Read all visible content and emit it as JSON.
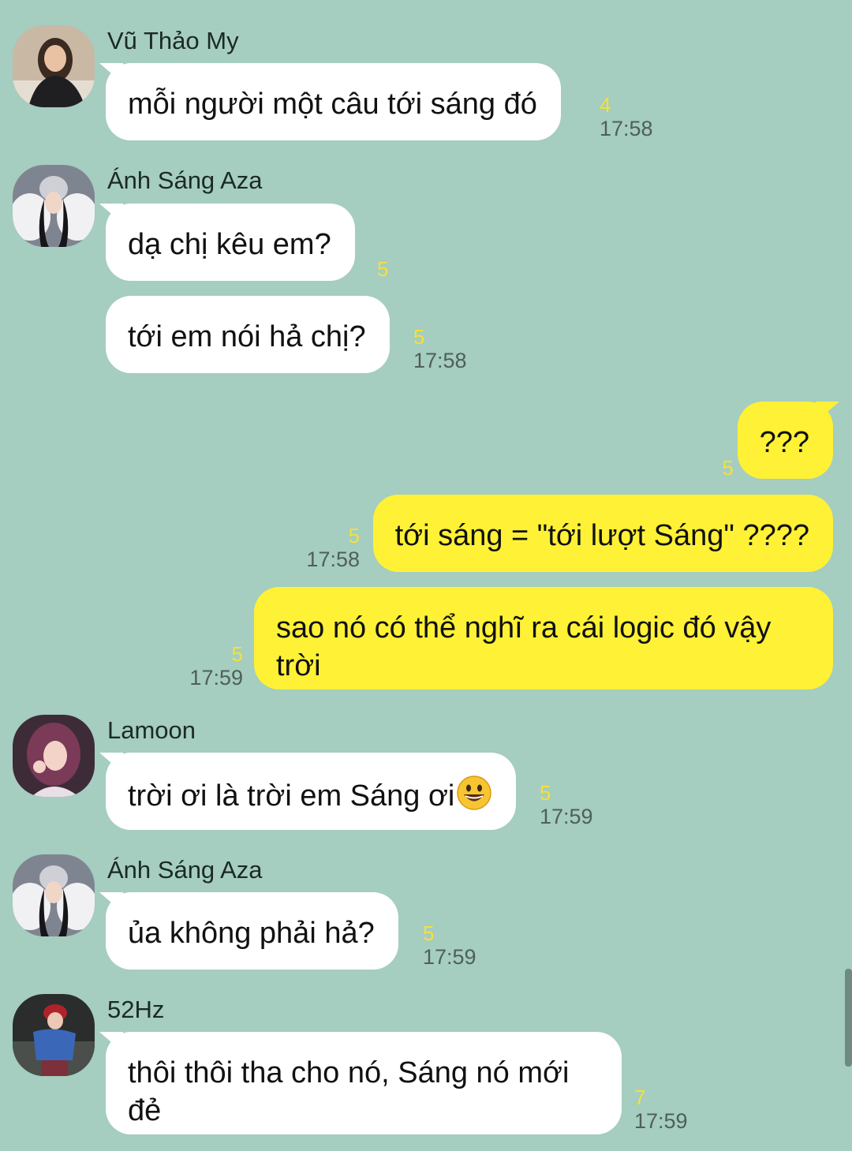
{
  "messages": [
    {
      "sender": "Vũ Thảo My",
      "text": "mỗi người một câu tới sáng đó",
      "unread": "4",
      "time": "17:58"
    },
    {
      "sender": "Ánh Sáng Aza",
      "text": "dạ chị kêu em?",
      "unread": "5",
      "time": ""
    },
    {
      "sender": "Ánh Sáng Aza",
      "text": "tới em nói hả chị?",
      "unread": "5",
      "time": "17:58"
    },
    {
      "sender": "me",
      "text": "???",
      "unread": "5",
      "time": ""
    },
    {
      "sender": "me",
      "text": "tới sáng = \"tới lượt Sáng\" ????",
      "unread": "5",
      "time": "17:58"
    },
    {
      "sender": "me",
      "text": "sao nó có thể nghĩ ra cái logic đó vậy trời",
      "unread": "5",
      "time": "17:59"
    },
    {
      "sender": "Lamoon",
      "text": "trời ơi là trời em Sáng ơi",
      "unread": "5",
      "time": "17:59"
    },
    {
      "sender": "Ánh Sáng Aza",
      "text": "ủa không phải hả?",
      "unread": "5",
      "time": "17:59"
    },
    {
      "sender": "52Hz",
      "text": "thôi thôi tha cho nó, Sáng nó mới đẻ",
      "unread": "7",
      "time": "17:59"
    }
  ],
  "emoji": "grinning-face-emoji",
  "colors": {
    "background": "#a5cdc0",
    "incoming_bubble": "#ffffff",
    "outgoing_bubble": "#fef136",
    "unread_count": "#f5e03a",
    "timestamp": "#4f5f5a"
  }
}
